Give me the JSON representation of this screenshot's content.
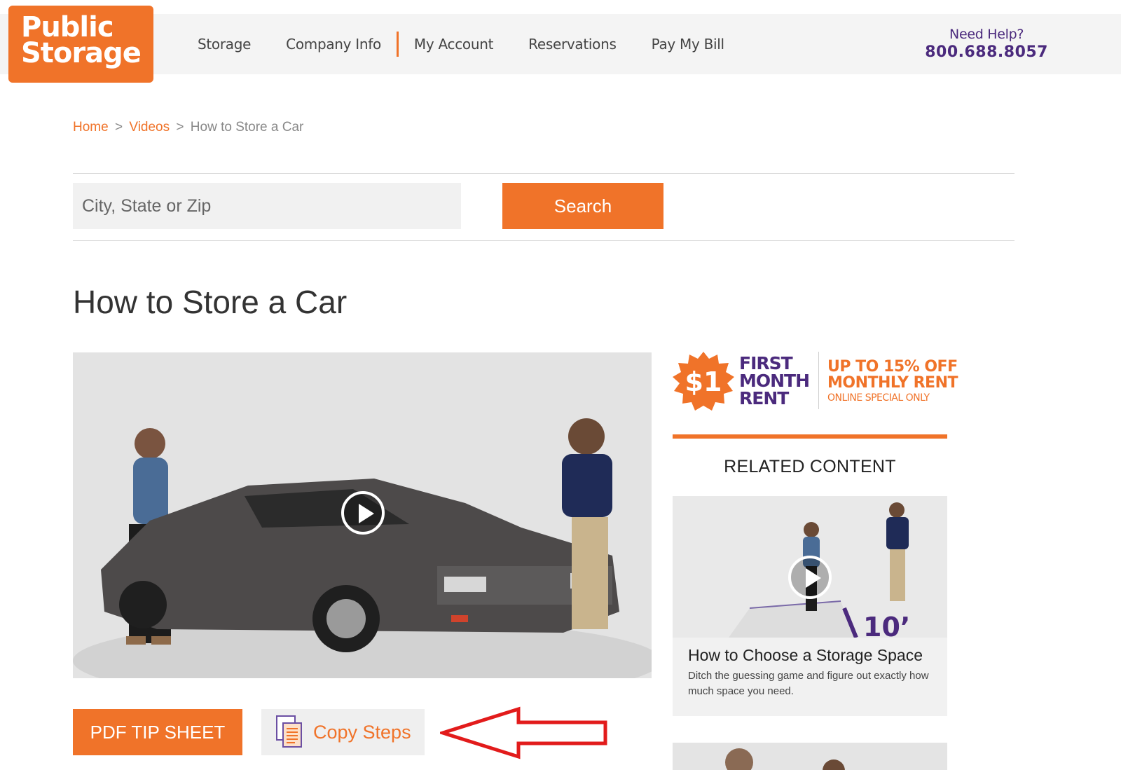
{
  "brand": {
    "logo_line1": "Public",
    "logo_line2": "Storage",
    "accent": "#f07329",
    "purple": "#4b2a7d"
  },
  "nav": {
    "items": [
      "Storage",
      "Company Info",
      "My Account",
      "Reservations",
      "Pay My Bill"
    ]
  },
  "help": {
    "label": "Need Help?",
    "phone": "800.688.8057"
  },
  "breadcrumb": {
    "home": "Home",
    "videos": "Videos",
    "current": "How to Store a Car",
    "separator": ">"
  },
  "search": {
    "placeholder": "City, State or Zip",
    "value": "",
    "button_label": "Search"
  },
  "page": {
    "title": "How to Store a Car"
  },
  "actions": {
    "pdf_label": "PDF TIP SHEET",
    "copy_label": "Copy Steps"
  },
  "promo": {
    "price": "$1",
    "line1": "FIRST",
    "line2": "MONTH",
    "line3": "RENT",
    "off_line1": "UP TO 15% OFF",
    "off_line2": "MONTHLY RENT",
    "off_line3": "ONLINE SPECIAL ONLY"
  },
  "related": {
    "heading": "RELATED CONTENT",
    "card_title": "How to Choose a Storage Space",
    "card_desc": "Ditch the guessing game and figure out exactly how much space you need.",
    "card_img_label": "10’"
  }
}
